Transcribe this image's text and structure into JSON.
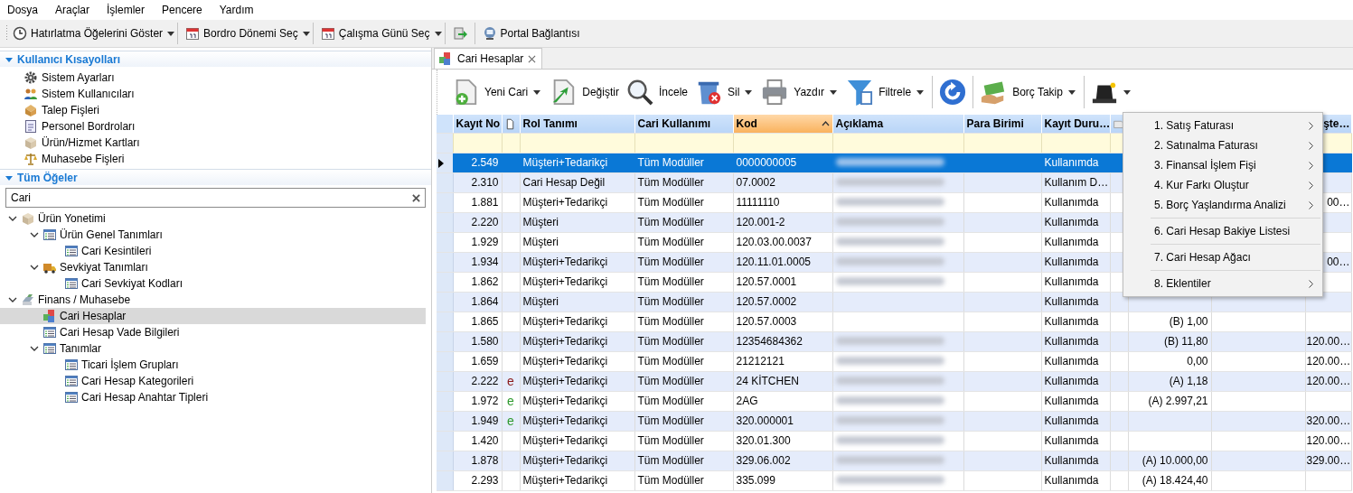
{
  "menu_bar": [
    "Dosya",
    "Araçlar",
    "İşlemler",
    "Pencere",
    "Yardım"
  ],
  "main_toolbar": [
    {
      "kind": "clock",
      "label": "Hatırlatma Öğelerini Göster",
      "dropdown": true
    },
    {
      "kind": "calendar",
      "label": "Bordro Dönemi Seç",
      "dropdown": true
    },
    {
      "kind": "calendar",
      "label": "Çalışma Günü Seç",
      "dropdown": true
    },
    {
      "kind": "export"
    },
    {
      "kind": "monitor",
      "label": "Portal Bağlantısı",
      "dropdown": false
    }
  ],
  "shortcuts": {
    "title": "Kullanıcı Kısayolları",
    "expanded": true,
    "items": [
      {
        "kind": "gear",
        "label": "Sistem Ayarları"
      },
      {
        "kind": "users",
        "label": "Sistem Kullanıcıları"
      },
      {
        "kind": "parcel",
        "label": "Talep Fişleri"
      },
      {
        "kind": "ledger",
        "label": "Personel Bordroları"
      },
      {
        "kind": "box",
        "label": "Ürün/Hizmet Kartları"
      },
      {
        "kind": "scale",
        "label": "Muhasebe Fişleri"
      }
    ]
  },
  "all_items": {
    "title": "Tüm Öğeler",
    "expanded": true,
    "search": {
      "value": "Cari"
    },
    "tree": [
      {
        "kind": "box",
        "label": "Ürün Yonetimi",
        "expanded": true,
        "selected": false,
        "children": [
          {
            "kind": "list",
            "label": "Ürün Genel Tanımları",
            "expanded": true,
            "selected": false,
            "children": [
              {
                "kind": "list",
                "label": "Cari Kesintileri",
                "selected": false
              }
            ]
          },
          {
            "kind": "truck",
            "label": "Sevkiyat Tanımları",
            "expanded": true,
            "selected": false,
            "children": [
              {
                "kind": "list",
                "label": "Cari Sevkiyat Kodları",
                "selected": false
              }
            ]
          }
        ]
      },
      {
        "kind": "money",
        "label": "Finans / Muhasebe",
        "expanded": true,
        "selected": false,
        "children": [
          {
            "kind": "cubes",
            "label": "Cari Hesaplar",
            "selected": true
          },
          {
            "kind": "list",
            "label": "Cari Hesap Vade Bilgileri",
            "selected": false
          },
          {
            "kind": "list",
            "label": "Tanımlar",
            "expanded": true,
            "selected": false,
            "children": [
              {
                "kind": "list",
                "label": "Ticari İşlem Grupları",
                "selected": false
              },
              {
                "kind": "list",
                "label": "Cari Hesap Kategorileri",
                "selected": false
              },
              {
                "kind": "list",
                "label": "Cari Hesap Anahtar Tipleri",
                "selected": false
              }
            ]
          }
        ]
      }
    ]
  },
  "tabs": [
    {
      "label": "Cari Hesaplar",
      "selected": true,
      "closable": true
    }
  ],
  "grid_toolbar": [
    {
      "kind": "doc-plus",
      "label": "Yeni Cari",
      "dropdown": true
    },
    {
      "kind": "doc-arrow",
      "label": "Değiştir",
      "dropdown": false
    },
    {
      "kind": "magnifier",
      "label": "İncele",
      "dropdown": false
    },
    {
      "kind": "bin",
      "label": "Sil",
      "dropdown": true
    },
    {
      "kind": "printer",
      "label": "Yazdır",
      "dropdown": true
    },
    {
      "kind": "funnel",
      "label": "Filtrele",
      "dropdown": true
    },
    {
      "kind": "separator"
    },
    {
      "kind": "refresh",
      "dropdown": false
    },
    {
      "kind": "separator"
    },
    {
      "kind": "money-hand",
      "label": "Borç Takip",
      "dropdown": true
    },
    {
      "kind": "separator"
    },
    {
      "kind": "hat",
      "dropdown": true
    }
  ],
  "table": {
    "columns": [
      {
        "kind": "text",
        "label": "Kayıt No"
      },
      {
        "kind": "doc"
      },
      {
        "kind": "text",
        "label": "Rol Tanımı"
      },
      {
        "kind": "text",
        "label": "Cari Kullanımı"
      },
      {
        "kind": "text",
        "label": "Kod",
        "sorted": true
      },
      {
        "kind": "text",
        "label": "Açıklama"
      },
      {
        "kind": "text",
        "label": "Para Birimi"
      },
      {
        "kind": "text",
        "label": "Kayıt Duru…"
      },
      {
        "kind": "note"
      },
      {
        "kind": "text"
      },
      {
        "kind": "text"
      },
      {
        "kind": "text",
        "label": "şte…"
      }
    ],
    "rows": [
      {
        "selected": true,
        "cells": [
          "2.549",
          "",
          "Müşteri+Tedarikçi",
          "Tüm Modüller",
          "0000000005",
          "",
          "",
          "Kullanımda",
          "",
          "",
          "",
          ""
        ],
        "blurred": true
      },
      {
        "selected": false,
        "cells": [
          "2.310",
          "",
          "Cari Hesap Değil",
          "Tüm Modüller",
          "07.0002",
          "",
          "",
          "Kullanım D…",
          "",
          "",
          "",
          ""
        ],
        "blurred": true
      },
      {
        "selected": false,
        "cells": [
          "1.881",
          "",
          "Müşteri+Tedarikçi",
          "Tüm Modüller",
          "11111110",
          "",
          "",
          "Kullanımda",
          "",
          "",
          "",
          "00…"
        ],
        "blurred": true
      },
      {
        "selected": false,
        "cells": [
          "2.220",
          "",
          "Müşteri",
          "Tüm Modüller",
          "120.001-2",
          "",
          "",
          "Kullanımda",
          "",
          "",
          "",
          ""
        ],
        "blurred": true
      },
      {
        "selected": false,
        "cells": [
          "1.929",
          "",
          "Müşteri",
          "Tüm Modüller",
          "120.03.00.0037",
          "",
          "",
          "Kullanımda",
          "",
          "",
          "",
          ""
        ],
        "blurred": true
      },
      {
        "selected": false,
        "cells": [
          "1.934",
          "",
          "Müşteri+Tedarikçi",
          "Tüm Modüller",
          "120.11.01.0005",
          "",
          "",
          "Kullanımda",
          "",
          "",
          "",
          "00…"
        ],
        "blurred": true
      },
      {
        "selected": false,
        "cells": [
          "1.862",
          "",
          "Müşteri+Tedarikçi",
          "Tüm Modüller",
          "120.57.0001",
          "",
          "",
          "Kullanımda",
          "",
          "",
          "",
          ""
        ],
        "blurred": true
      },
      {
        "selected": false,
        "cells": [
          "1.864",
          "",
          "Müşteri",
          "Tüm Modüller",
          "120.57.0002",
          "",
          "",
          "Kullanımda",
          "",
          "",
          "",
          ""
        ],
        "blurred": false
      },
      {
        "selected": false,
        "cells": [
          "1.865",
          "",
          "Müşteri+Tedarikçi",
          "Tüm Modüller",
          "120.57.0003",
          "",
          "",
          "Kullanımda",
          "",
          "(B) 1,00",
          "",
          ""
        ],
        "blurred": false
      },
      {
        "selected": false,
        "cells": [
          "1.580",
          "",
          "Müşteri+Tedarikçi",
          "Tüm Modüller",
          "12354684362",
          "",
          "",
          "Kullanımda",
          "",
          "(B) 11,80",
          "",
          "120.00…"
        ],
        "blurred": true
      },
      {
        "selected": false,
        "cells": [
          "1.659",
          "",
          "Müşteri+Tedarikçi",
          "Tüm Modüller",
          "21212121",
          "",
          "",
          "Kullanımda",
          "",
          "0,00",
          "",
          "120.00…"
        ],
        "blurred": true
      },
      {
        "selected": false,
        "cells": [
          "2.222",
          "e",
          "Müşteri+Tedarikçi",
          "Tüm Modüller",
          "24 KİTCHEN",
          "",
          "",
          "Kullanımda",
          "",
          "(A) 1,18",
          "",
          "120.00…"
        ],
        "color": "#8b1a1a",
        "blurred": true
      },
      {
        "selected": false,
        "cells": [
          "1.972",
          "e",
          "Müşteri+Tedarikçi",
          "Tüm Modüller",
          "2AG",
          "",
          "",
          "Kullanımda",
          "",
          "(A) 2.997,21",
          "",
          ""
        ],
        "color": "#2e9a2e",
        "blurred": true
      },
      {
        "selected": false,
        "cells": [
          "1.949",
          "e",
          "Müşteri+Tedarikçi",
          "Tüm Modüller",
          "320.000001",
          "",
          "",
          "Kullanımda",
          "",
          "",
          "",
          "320.00…"
        ],
        "color": "#2e9a2e",
        "blurred": true
      },
      {
        "selected": false,
        "cells": [
          "1.420",
          "",
          "Müşteri+Tedarikçi",
          "Tüm Modüller",
          "320.01.300",
          "",
          "",
          "Kullanımda",
          "",
          "",
          "",
          "120.00…"
        ],
        "blurred": true
      },
      {
        "selected": false,
        "cells": [
          "1.878",
          "",
          "Müşteri+Tedarikçi",
          "Tüm Modüller",
          "329.06.002",
          "",
          "",
          "Kullanımda",
          "",
          "(A) 10.000,00",
          "",
          "329.00…"
        ],
        "blurred": true
      },
      {
        "selected": false,
        "cells": [
          "2.293",
          "",
          "Müşteri+Tedarikçi",
          "Tüm Modüller",
          "335.099",
          "",
          "",
          "Kullanımda",
          "",
          "(A) 18.424,40",
          "",
          ""
        ],
        "blurred": true
      }
    ]
  },
  "context_menu": {
    "items": [
      {
        "label": "1. Satış Faturası",
        "submenu": true
      },
      {
        "label": "2. Satınalma Faturası",
        "submenu": true
      },
      {
        "label": "3. Finansal İşlem Fişi",
        "submenu": true
      },
      {
        "label": "4. Kur Farkı Oluştur",
        "submenu": true
      },
      {
        "label": "5. Borç Yaşlandırma Analizi",
        "submenu": true,
        "separator_after": true
      },
      {
        "label": "6. Cari Hesap Bakiye Listesi",
        "submenu": false,
        "separator_after": true
      },
      {
        "label": "7. Cari Hesap Ağacı",
        "submenu": false,
        "separator_after": true
      },
      {
        "label": "8. Eklentiler",
        "submenu": true
      }
    ]
  }
}
